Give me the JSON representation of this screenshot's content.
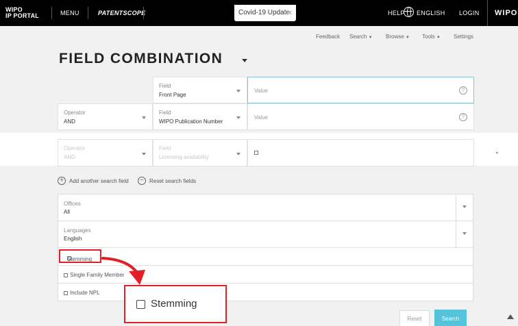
{
  "topbar": {
    "logo_line1": "WIPO",
    "logo_line2": "IP PORTAL",
    "menu": "MENU",
    "patentscope": "PATENTSCOPE",
    "covid": "Covid-19 Update",
    "help": "HELP",
    "language": "ENGLISH",
    "login": "LOGIN",
    "brand": "WIPO"
  },
  "subnav": {
    "feedback": "Feedback",
    "search": "Search",
    "browse": "Browse",
    "tools": "Tools",
    "settings": "Settings"
  },
  "page": {
    "title": "FIELD COMBINATION"
  },
  "rows": [
    {
      "operator_label": "",
      "operator_value": "",
      "field_label": "Field",
      "field_value": "Front Page",
      "value_placeholder": "Value"
    },
    {
      "operator_label": "Operator",
      "operator_value": "AND",
      "field_label": "Field",
      "field_value": "WIPO Publication Number",
      "value_placeholder": "Value"
    },
    {
      "operator_label": "Operator",
      "operator_value": "AND",
      "field_label": "Field",
      "field_value": "Licensing availability"
    }
  ],
  "help_glyph": "?",
  "actions": {
    "add": "Add another search field",
    "reset": "Reset search fields",
    "add_glyph": "+",
    "reset_glyph": "−"
  },
  "filters": {
    "offices_label": "Offices",
    "offices_value": "All",
    "languages_label": "Languages",
    "languages_value": "English",
    "stemming": "Stemming",
    "single_family": "Single Family Member",
    "include_npl": "Include NPL"
  },
  "callout": {
    "stemming": "Stemming"
  },
  "buttons": {
    "reset": "Reset",
    "search": "Search"
  },
  "colors": {
    "highlight": "#e21f26",
    "search_button": "#56c3dc",
    "topbar": "#000000"
  }
}
